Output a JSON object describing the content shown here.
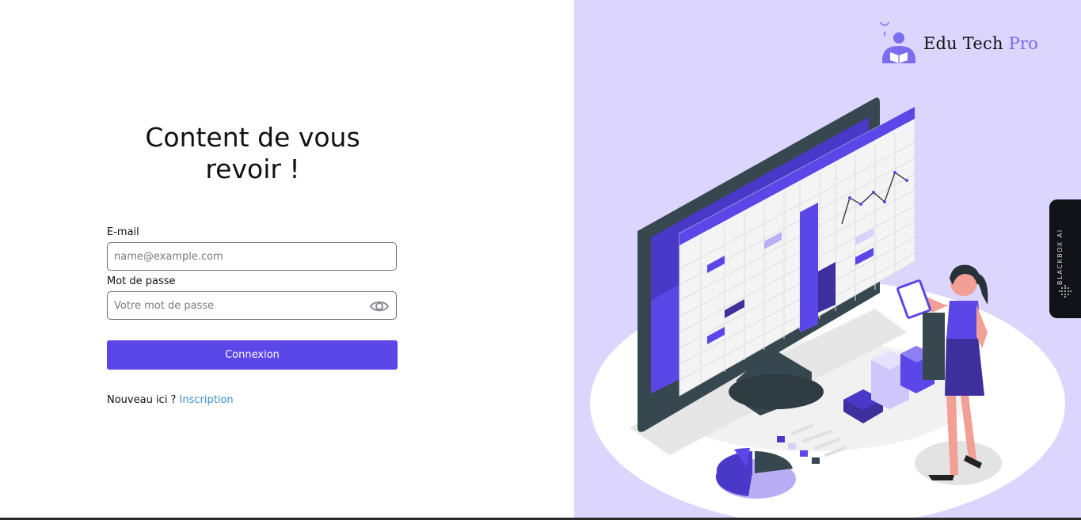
{
  "login": {
    "title": "Content de vous revoir !",
    "email_label": "E-mail",
    "email_placeholder": "name@example.com",
    "password_label": "Mot de passe",
    "password_placeholder": "Votre mot de passe",
    "submit_label": "Connexion",
    "signup_prompt": "Nouveau ici ?",
    "signup_link": "Inscription"
  },
  "brand": {
    "name_main": "Edu Tech",
    "name_accent": "Pro"
  },
  "extension_tab": {
    "label": "BLACKBOX AI"
  },
  "colors": {
    "accent": "#5b47e8",
    "right_panel_bg": "#dcd5fd",
    "link": "#3a8fd4",
    "brand_accent": "#7b6cf0"
  },
  "icons": {
    "password_toggle": "eye-icon",
    "brand_logo": "teacher-reading-icon",
    "extension_logo": "blackbox-dots-icon"
  }
}
